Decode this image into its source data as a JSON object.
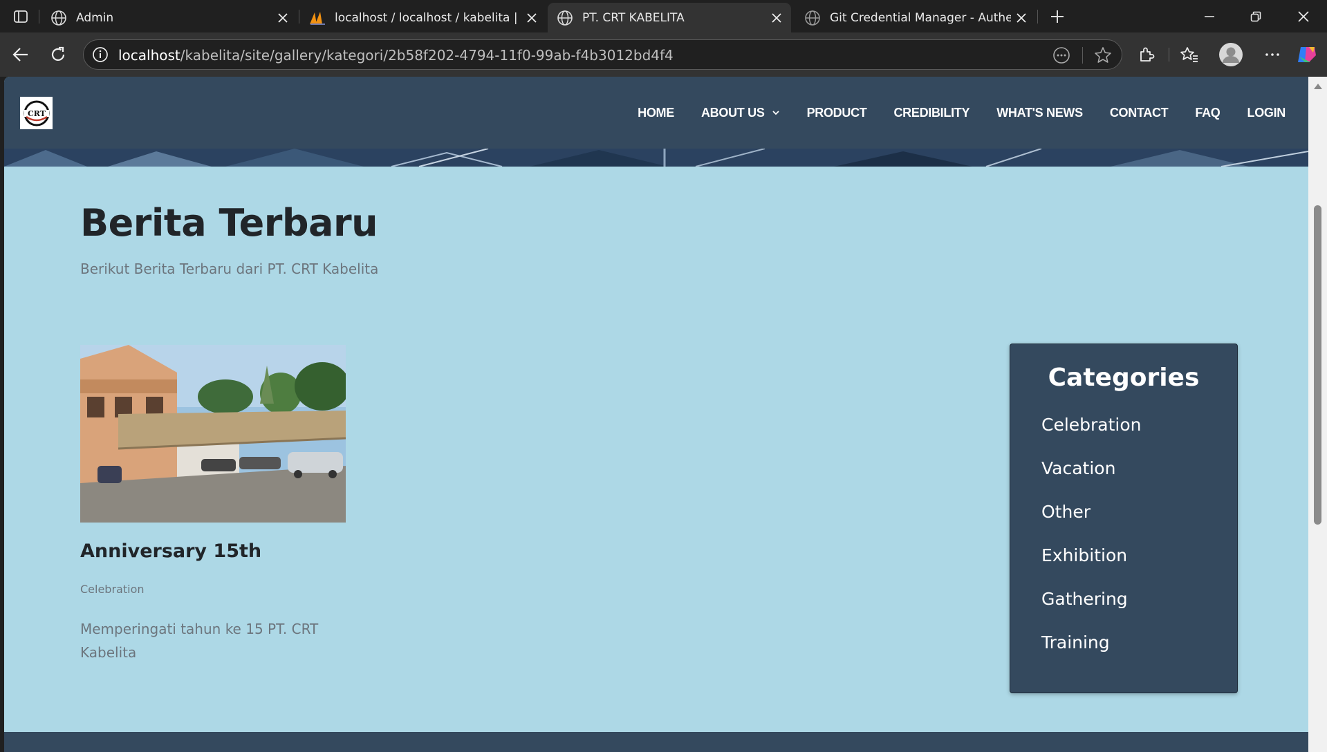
{
  "browser": {
    "tabs": [
      {
        "label": "Admin",
        "icon": "globe-icon",
        "active": false
      },
      {
        "label": "localhost / localhost / kabelita | pl",
        "icon": "phpmyadmin-icon",
        "active": false
      },
      {
        "label": "PT. CRT KABELITA",
        "icon": "globe-icon",
        "active": true
      },
      {
        "label": "Git Credential Manager - Authent",
        "icon": "globe-icon",
        "active": false
      }
    ],
    "url_host": "localhost",
    "url_path": "/kabelita/site/gallery/kategori/2b58f202-4794-11f0-99ab-f4b3012bd4f4"
  },
  "site": {
    "logo_text": "CRT",
    "nav": {
      "home": "HOME",
      "about": "ABOUT US",
      "product": "PRODUCT",
      "credibility": "CREDIBILITY",
      "news": "WHAT'S NEWS",
      "contact": "CONTACT",
      "faq": "FAQ",
      "login": "LOGIN"
    },
    "page_title": "Berita Terbaru",
    "page_subtitle": "Berikut Berita Terbaru dari PT. CRT Kabelita",
    "post": {
      "title": "Anniversary 15th",
      "category": "Celebration",
      "description": "Memperingati tahun ke 15 PT. CRT Kabelita"
    },
    "categories": {
      "title": "Categories",
      "items": [
        "Celebration",
        "Vacation",
        "Other",
        "Exhibition",
        "Gathering",
        "Training"
      ]
    }
  },
  "colors": {
    "header_bg": "#34495e",
    "page_bg": "#add8e6",
    "title_text": "#212529",
    "muted_text": "#6c757d"
  }
}
